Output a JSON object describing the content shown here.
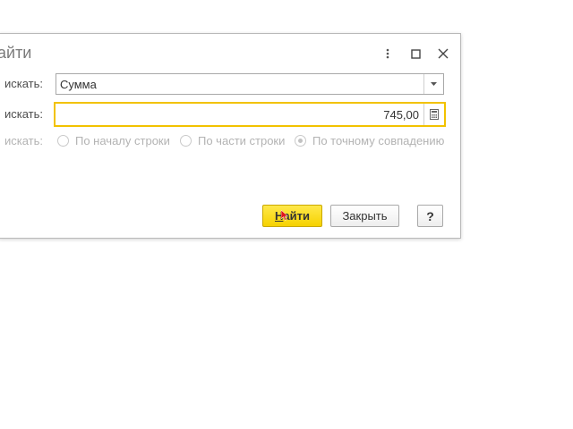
{
  "dialog": {
    "title": "айти",
    "menu_icon": "more-vertical-icon",
    "maximize_icon": "maximize-icon",
    "close_icon": "close-icon"
  },
  "form": {
    "field_label": "искать:",
    "field_value": "Сумма",
    "dropdown_icon": "chevron-down-icon",
    "value_label": "искать:",
    "value_value": "745,00",
    "calculator_icon": "calculator-icon",
    "mode_label": "искать:",
    "modes": [
      {
        "label": "По началу строки",
        "checked": false
      },
      {
        "label": "По части строки",
        "checked": false
      },
      {
        "label": "По точному совпадению",
        "checked": true
      }
    ]
  },
  "buttons": {
    "find_prefix": "Н",
    "find_rest": "айти",
    "close": "Закрыть",
    "help": "?"
  },
  "colors": {
    "accent_yellow": "#f6d200",
    "focus_border": "#f2c200"
  }
}
